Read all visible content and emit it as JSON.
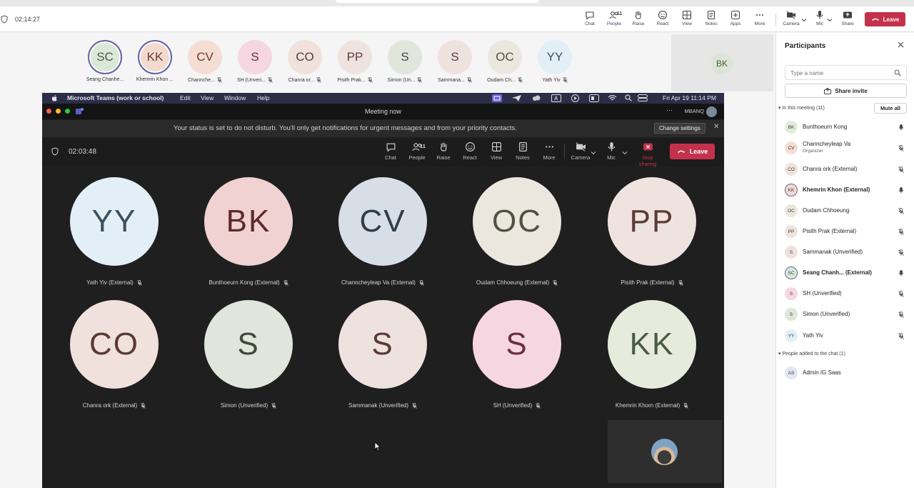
{
  "toolbar": {
    "timer": "02:14:27",
    "buttons": [
      {
        "label": "Chat",
        "icon": "chat-icon"
      },
      {
        "label": "People",
        "icon": "people-icon",
        "count": "11"
      },
      {
        "label": "Raise",
        "icon": "raise-hand-icon"
      },
      {
        "label": "React",
        "icon": "react-icon"
      },
      {
        "label": "View",
        "icon": "view-icon"
      },
      {
        "label": "Notes",
        "icon": "notes-icon"
      },
      {
        "label": "Apps",
        "icon": "apps-icon"
      },
      {
        "label": "More",
        "icon": "more-icon"
      },
      {
        "label": "Camera",
        "icon": "camera-icon"
      },
      {
        "label": "Mic",
        "icon": "mic-icon"
      },
      {
        "label": "Share",
        "icon": "share-icon"
      }
    ],
    "leave_label": "Leave",
    "leave_color": "#c4314b",
    "accent": "#5b5fc7"
  },
  "avatars": [
    {
      "initials": "SC",
      "name": "Seang Chanhe...",
      "bg": "#dce8d7",
      "fg": "#4a5b44"
    },
    {
      "initials": "KK",
      "name": "Khemrin Khon ...",
      "bg": "#f2dad0",
      "fg": "#6b3b2e"
    },
    {
      "initials": "CV",
      "name": "Channche...",
      "bg": "#f5ddd3",
      "fg": "#6b3b2e"
    },
    {
      "initials": "S",
      "name": "SH (Unveri...",
      "bg": "#f6d6e0",
      "fg": "#6b2e42"
    },
    {
      "initials": "CO",
      "name": "Chanra or...",
      "bg": "#f0e1dc",
      "fg": "#5a3b34"
    },
    {
      "initials": "PP",
      "name": "Pisith Prak...",
      "bg": "#efe3e0",
      "fg": "#5a3b34"
    },
    {
      "initials": "S",
      "name": "Simon (Un...",
      "bg": "#e0e6dc",
      "fg": "#3f4a3a"
    },
    {
      "initials": "S",
      "name": "Sammana...",
      "bg": "#eee2de",
      "fg": "#5a3b34"
    },
    {
      "initials": "OC",
      "name": "Oudam Ch...",
      "bg": "#ece7de",
      "fg": "#4f5141"
    },
    {
      "initials": "YY",
      "name": "Yath Yiv",
      "bg": "#e2eff6",
      "fg": "#3b5160"
    }
  ],
  "self_preview": {
    "initials": "BK"
  },
  "mac_menubar": {
    "app_name": "Microsoft Teams (work or school)",
    "menus": [
      "Edit",
      "View",
      "Window",
      "Help"
    ],
    "datetime": "Fri Apr 19  11:14 PM"
  },
  "inner_window": {
    "title": "Meeting now",
    "account": "MBANQ",
    "banner": "Your status is set to do not disturb. You'll only get notifications for urgent messages and from your priority contacts.",
    "change_settings": "Change settings",
    "timer": "02:03:48",
    "buttons": [
      {
        "label": "Chat",
        "icon": "chat-icon"
      },
      {
        "label": "People",
        "icon": "people-icon",
        "count": "11"
      },
      {
        "label": "Raise",
        "icon": "raise-hand-icon"
      },
      {
        "label": "React",
        "icon": "react-icon"
      },
      {
        "label": "View",
        "icon": "view-icon"
      },
      {
        "label": "Notes",
        "icon": "notes-icon"
      },
      {
        "label": "More",
        "icon": "more-icon"
      },
      {
        "label": "Camera",
        "icon": "camera-icon"
      },
      {
        "label": "Mic",
        "icon": "mic-icon"
      },
      {
        "label": "Stop sharing",
        "icon": "stop-sharing-icon"
      }
    ],
    "leave_label": "Leave"
  },
  "tiles": [
    {
      "initials": "YY",
      "name": "Yath Yiv (External)",
      "bg": "#e2eff6",
      "fg": "#3b5160"
    },
    {
      "initials": "BK",
      "name": "Bunthoeurn Kong (External)",
      "bg": "#f0d2d2",
      "fg": "#5c2a2a"
    },
    {
      "initials": "CV",
      "name": "Channcheyleap Va (External)",
      "bg": "#d7dee6",
      "fg": "#2f3e4a"
    },
    {
      "initials": "OC",
      "name": "Oudam Chhoeung (External)",
      "bg": "#ece7de",
      "fg": "#4f5141"
    },
    {
      "initials": "PP",
      "name": "Pisith Prak (External)",
      "bg": "#efe3e0",
      "fg": "#5a3b34"
    },
    {
      "initials": "CO",
      "name": "Chanra ork (External)",
      "bg": "#f0e1dc",
      "fg": "#5a3b34"
    },
    {
      "initials": "S",
      "name": "Simon (Unverified)",
      "bg": "#e0e6dc",
      "fg": "#3f4a3a"
    },
    {
      "initials": "S",
      "name": "Sammanak (Unverified)",
      "bg": "#eee2de",
      "fg": "#5a3b34"
    },
    {
      "initials": "S",
      "name": "SH (Unverified)",
      "bg": "#f6d6e0",
      "fg": "#6b2e42"
    },
    {
      "initials": "KK",
      "name": "Khemrin Khorn (External)",
      "bg": "#e6ebdc",
      "fg": "#4a5b44"
    }
  ],
  "panel": {
    "title": "Participants",
    "search_placeholder": "Type a name",
    "share_invite": "Share invite",
    "in_meeting": "In this meeting (11)",
    "mute_all": "Mute all",
    "participants": [
      {
        "initials": "BK",
        "name": "Bunthoeurn Kong",
        "bg": "#e3ebdc",
        "muted": false
      },
      {
        "initials": "CV",
        "name": "Channcheyleap Va",
        "role": "Organizer",
        "bg": "#f5ddd3",
        "muted": true
      },
      {
        "initials": "CO",
        "name": "Chanra ork (External)",
        "bg": "#f0e1dc",
        "muted": true
      },
      {
        "initials": "KK",
        "name": "Khemrin Khon (External)",
        "bg": "#f2dad0",
        "muted": false,
        "bold": true,
        "highlight": true
      },
      {
        "initials": "OC",
        "name": "Oudam Chhoeung",
        "bg": "#ece7de",
        "muted": true
      },
      {
        "initials": "PP",
        "name": "Pisith Prak (External)",
        "bg": "#efe3e0",
        "muted": true
      },
      {
        "initials": "S",
        "name": "Sammanak (Unverified)",
        "bg": "#eee2de",
        "muted": true
      },
      {
        "initials": "SC",
        "name": "Seang Chanh...  (External)",
        "bg": "#dce8d7",
        "muted": false,
        "bold": true,
        "highlight": true
      },
      {
        "initials": "S",
        "name": "SH (Unverified)",
        "bg": "#f6d6e0",
        "muted": true
      },
      {
        "initials": "S",
        "name": "Simon (Unverified)",
        "bg": "#e0e6dc",
        "muted": true
      },
      {
        "initials": "YY",
        "name": "Yath Yiv",
        "bg": "#e2eff6",
        "muted": true
      }
    ],
    "added_section": "People added to the chat (1)",
    "added": [
      {
        "initials": "AS",
        "name": "Admin IG Saas",
        "bg": "#e4e4f2"
      }
    ]
  }
}
